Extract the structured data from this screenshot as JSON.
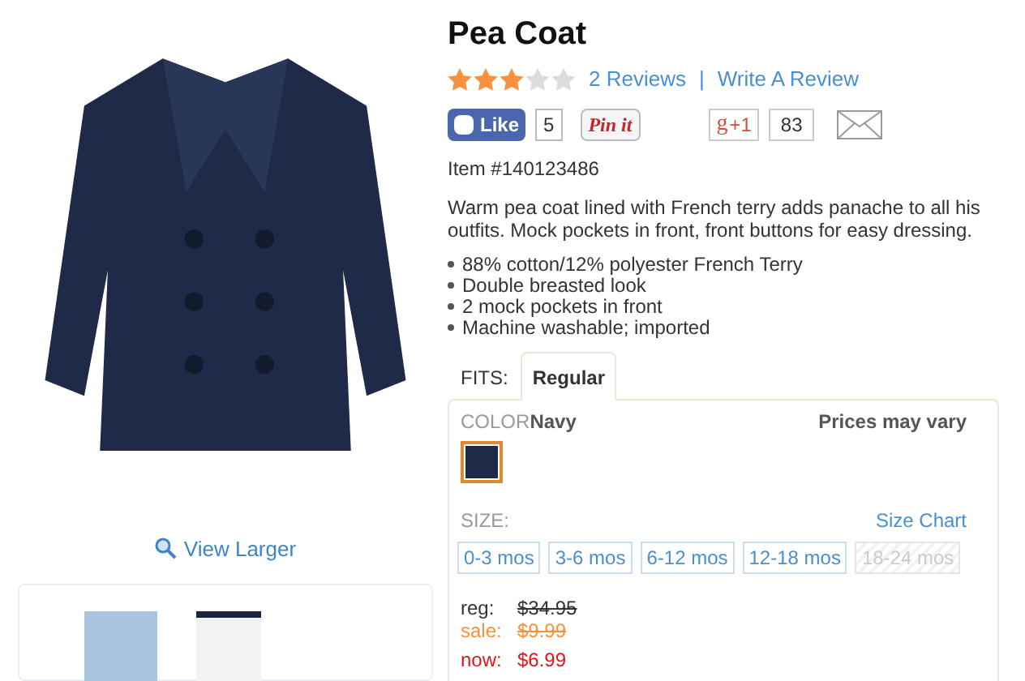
{
  "product": {
    "title": "Pea Coat",
    "stars": 3,
    "reviews_link": "2 Reviews",
    "separator": "|",
    "write_review_link": "Write A Review",
    "item_number": "Item #140123486",
    "description": "Warm pea coat lined with French terry adds panache to all his outfits. Mock pockets in front, front buttons for easy dressing.",
    "features": [
      "88% cotton/12% polyester French Terry",
      "Double breasted look",
      "2 mock pockets in front",
      "Machine washable; imported"
    ]
  },
  "social": {
    "like_label": "Like",
    "like_count": "5",
    "pin_label": "Pin it",
    "gplus_letter": "g",
    "gplus_label": "+1",
    "gplus_count": "83"
  },
  "view_larger": "View Larger",
  "fits": {
    "label": "FITS:",
    "tabs": [
      {
        "label": "Regular",
        "selected": true
      }
    ]
  },
  "color": {
    "label": "COLOR",
    "value": "Navy",
    "prices_note": "Prices may vary",
    "swatches": [
      {
        "color": "#1e2a47",
        "selected": true
      }
    ]
  },
  "size": {
    "label": "SIZE:",
    "chart_link": "Size Chart",
    "options": [
      {
        "label": "0-3 mos",
        "disabled": false
      },
      {
        "label": "3-6 mos",
        "disabled": false
      },
      {
        "label": "6-12 mos",
        "disabled": false
      },
      {
        "label": "12-18 mos",
        "disabled": false
      },
      {
        "label": "18-24 mos",
        "disabled": true
      }
    ]
  },
  "prices": [
    {
      "kind": "reg",
      "label": "reg:",
      "value": "$34.95"
    },
    {
      "kind": "sale",
      "label": "sale:",
      "value": "$9.99"
    },
    {
      "kind": "now",
      "label": "now:",
      "value": "$6.99"
    }
  ]
}
